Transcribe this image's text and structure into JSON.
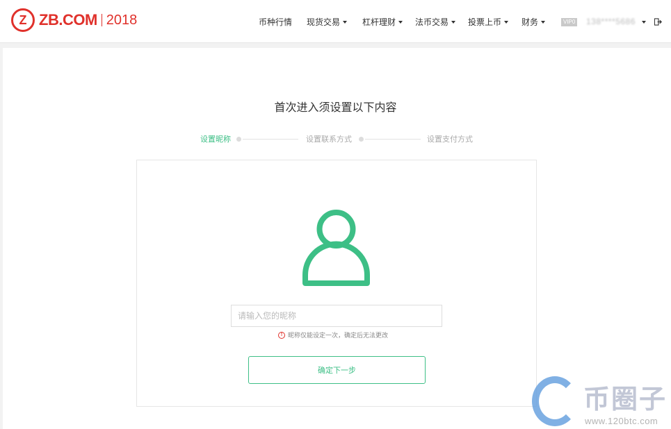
{
  "brand": {
    "logo_mark": "Z",
    "logo_text": "ZB.COM",
    "logo_year": "2018",
    "accent_color": "#e0312b"
  },
  "nav": {
    "items": [
      {
        "label": "币种行情",
        "has_caret": false
      },
      {
        "label": "现货交易",
        "has_caret": true
      },
      {
        "label": "杠杆理财",
        "has_caret": true
      },
      {
        "label": "法币交易",
        "has_caret": true
      },
      {
        "label": "投票上币",
        "has_caret": true
      },
      {
        "label": "财务",
        "has_caret": true
      }
    ],
    "vip_badge": "VIP0",
    "account": "138****5686"
  },
  "page": {
    "title": "首次进入须设置以下内容",
    "steps": [
      {
        "label": "设置昵称",
        "active": true
      },
      {
        "label": "设置联系方式",
        "active": false
      },
      {
        "label": "设置支付方式",
        "active": false
      }
    ],
    "accent_color": "#3dbf86"
  },
  "form": {
    "avatar_icon": "user-icon",
    "nickname_placeholder": "请输入您的昵称",
    "nickname_value": "",
    "hint": "昵称仅能设定一次，确定后无法更改",
    "hint_icon": "!",
    "submit_label": "确定下一步"
  },
  "watermark": {
    "title": "币圈子",
    "url": "www.120btc.com"
  }
}
